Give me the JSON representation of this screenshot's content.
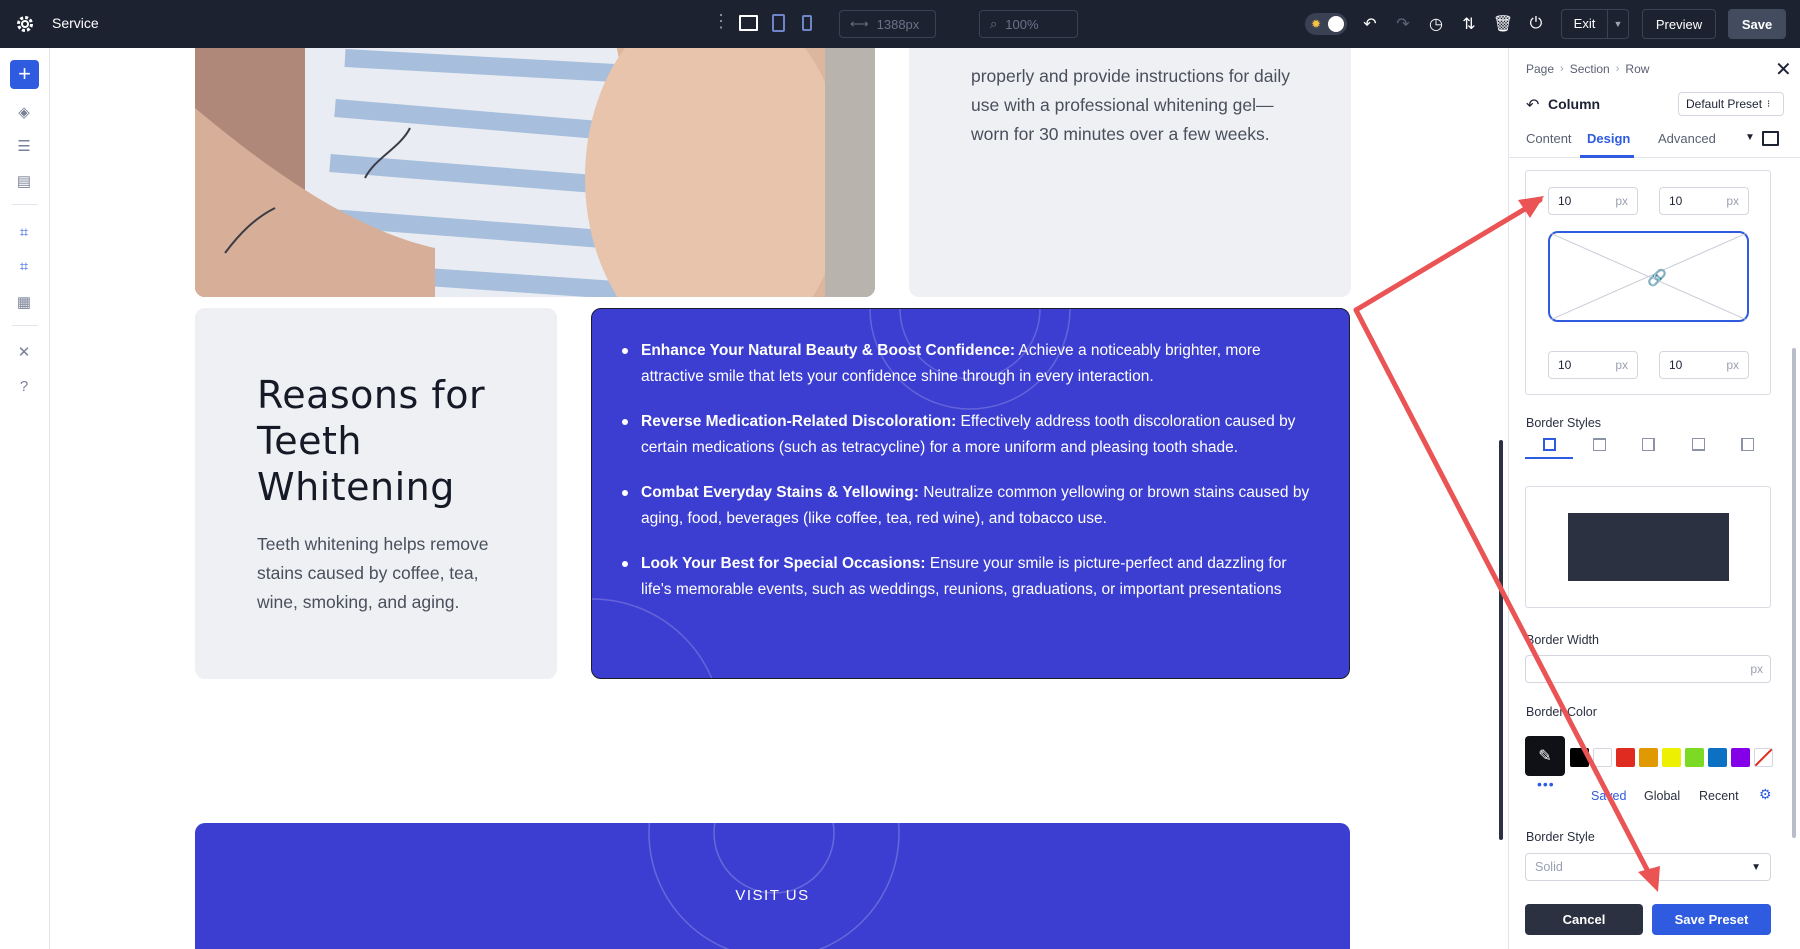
{
  "app": {
    "title": "Service"
  },
  "toolbar": {
    "width_value": "1388px",
    "zoom_value": "100%",
    "exit_label": "Exit",
    "preview_label": "Preview",
    "save_label": "Save"
  },
  "canvas": {
    "top_card_text": "properly and provide instructions for daily use with a professional whitening gel—worn for 30 minutes over a few weeks.",
    "reasons_title": "Reasons for Teeth Whitening",
    "reasons_desc": "Teeth whitening helps remove stains caused by coffee, tea, wine, smoking, and aging.",
    "benefits": [
      {
        "bold": "Enhance Your Natural Beauty & Boost Confidence:",
        "text": " Achieve a noticeably brighter, more attractive smile that lets your confidence shine through in every interaction."
      },
      {
        "bold": "Reverse Medication-Related Discoloration:",
        "text": " Effectively address tooth discoloration caused by certain medications (such as tetracycline) for a more uniform and pleasing tooth shade."
      },
      {
        "bold": "Combat Everyday Stains & Yellowing:",
        "text": " Neutralize common yellowing or brown stains caused by aging, food, beverages (like coffee, tea, red wine), and tobacco use."
      },
      {
        "bold": "Look Your Best for Special Occasions:",
        "text": " Ensure your smile is picture-perfect and dazzling for life's memorable events, such as weddings, reunions, graduations, or important presentations"
      }
    ],
    "visit_label": "VISIT US"
  },
  "panel": {
    "breadcrumb": [
      "Page",
      "Section",
      "Row"
    ],
    "element_title": "Column",
    "preset_label": "Default Preset",
    "tabs": [
      "Content",
      "Design",
      "Advanced"
    ],
    "active_tab": "Design",
    "radius": {
      "top_left": "10",
      "top_right": "10",
      "bottom_left": "10",
      "bottom_right": "10",
      "unit": "px"
    },
    "border_styles_label": "Border Styles",
    "border_width_label": "Border Width",
    "border_width_unit": "px",
    "border_color_label": "Border Color",
    "color_tabs": [
      "Saved",
      "Global",
      "Recent"
    ],
    "swatches": [
      "#000000",
      "#ffffff",
      "#e02b20",
      "#e09900",
      "#edf000",
      "#7cda24",
      "#0c71c3",
      "#8300e9"
    ],
    "border_style_label": "Border Style",
    "border_style_value": "Solid",
    "cancel_label": "Cancel",
    "save_preset_label": "Save Preset"
  },
  "colors": {
    "topbar_bg": "#1d2231",
    "accent": "#2e5bdf",
    "card_blue": "#3c3ed1",
    "annotation_arrow": "#ea5455"
  }
}
